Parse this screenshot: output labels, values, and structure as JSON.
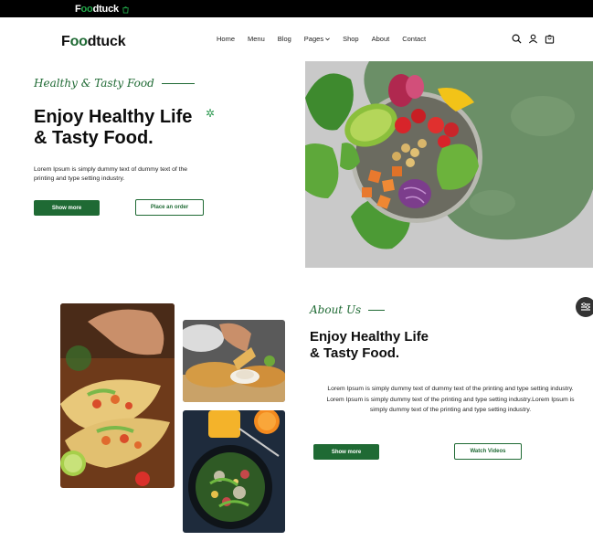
{
  "topbar": {
    "brand_prefix": "F",
    "brand_oo": "oo",
    "brand_suffix": "dtuck",
    "bag_icon": "bag-icon"
  },
  "header": {
    "logo_prefix": "F",
    "logo_oo": "oo",
    "logo_suffix": "dtuck",
    "nav": [
      "Home",
      "Menu",
      "Blog",
      "Pages",
      "Shop",
      "About",
      "Contact"
    ],
    "icons": [
      "search-icon",
      "user-icon",
      "bag-icon"
    ]
  },
  "hero": {
    "tagline": "Healthy & Tasty Food",
    "title_line1": "Enjoy Healthy Life",
    "title_line2": "& Tasty Food.",
    "description": "Lorem Ipsum is simply dummy text of dummy text of the printing and type setting industry.",
    "primary_button": "Show more",
    "secondary_button": "Place an order"
  },
  "about": {
    "tagline": "About Us",
    "title_line1": "Enjoy Healthy Life",
    "title_line2": "& Tasty Food.",
    "description": "Lorem Ipsum is simply dummy text of dummy text of the printing and type setting industry. Lorem Ipsum is simply dummy text of the printing and type setting industry.Lorem Ipsum is simply dummy text of the printing and type setting industry.",
    "primary_button": "Show more",
    "secondary_button": "Watch Videos"
  },
  "colors": {
    "brand_green": "#1f6a34",
    "topbar": "#000000",
    "hero_bg": "#c9c9c9",
    "blob": "#6b8f67"
  }
}
